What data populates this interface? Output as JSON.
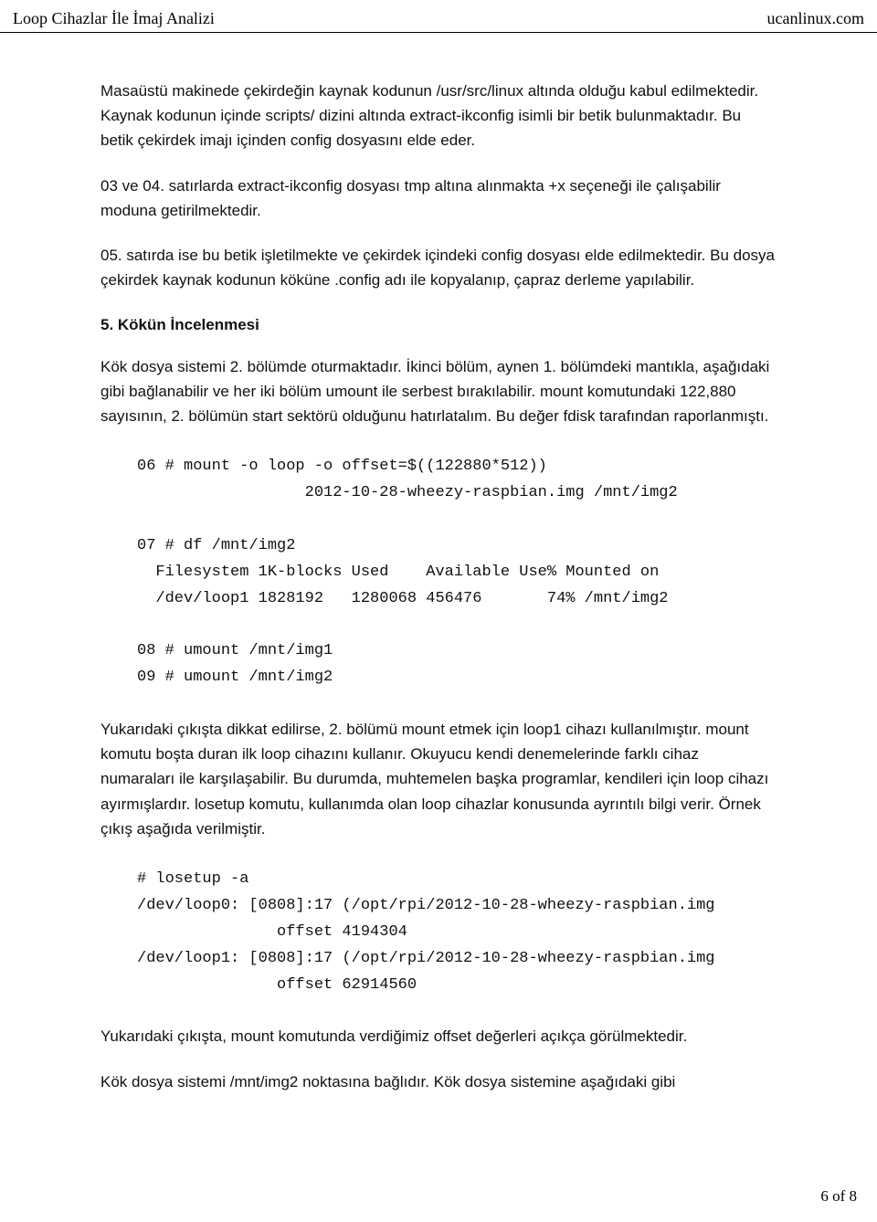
{
  "header": {
    "left": "Loop Cihazlar İle İmaj Analizi",
    "right": "ucanlinux.com"
  },
  "paragraphs": {
    "p1": "Masaüstü makinede çekirdeğin kaynak kodunun /usr/src/linux altında olduğu kabul edilmektedir. Kaynak kodunun içinde scripts/ dizini altında extract-ikconfig isimli bir betik bulunmaktadır. Bu betik çekirdek imajı içinden config dosyasını elde eder.",
    "p2": "03 ve 04. satırlarda extract-ikconfig dosyası tmp altına alınmakta +x seçeneği ile çalışabilir moduna getirilmektedir.",
    "p3": "05. satırda ise bu betik işletilmekte ve çekirdek içindeki config dosyası elde edilmektedir. Bu dosya çekirdek kaynak kodunun köküne .config adı ile kopyalanıp, çapraz derleme yapılabilir.",
    "sectionTitle": "5. Kökün İncelenmesi",
    "p4": "Kök dosya sistemi 2. bölümde oturmaktadır. İkinci bölüm, aynen 1. bölümdeki mantıkla, aşağıdaki gibi bağlanabilir ve her iki bölüm umount ile serbest bırakılabilir. mount komutundaki 122,880 sayısının, 2. bölümün start sektörü olduğunu hatırlatalım. Bu değer fdisk tarafından raporlanmıştı.",
    "p5": "Yukarıdaki çıkışta dikkat edilirse, 2. bölümü mount etmek için loop1 cihazı kullanılmıştır. mount komutu boşta duran ilk loop cihazını kullanır. Okuyucu kendi denemelerinde farklı cihaz numaraları ile karşılaşabilir. Bu durumda, muhtemelen başka programlar, kendileri için loop cihazı ayırmışlardır. losetup komutu, kullanımda olan loop cihazlar konusunda ayrıntılı bilgi verir. Örnek çıkış aşağıda verilmiştir.",
    "p6": "Yukarıdaki çıkışta, mount komutunda verdiğimiz offset değerleri açıkça görülmektedir.",
    "p7": "Kök dosya sistemi /mnt/img2 noktasına bağlıdır. Kök dosya sistemine aşağıdaki gibi"
  },
  "code1": "06 # mount -o loop -o offset=$((122880*512))\n                  2012-10-28-wheezy-raspbian.img /mnt/img2\n\n07 # df /mnt/img2\n  Filesystem 1K-blocks Used    Available Use% Mounted on\n  /dev/loop1 1828192   1280068 456476       74% /mnt/img2\n\n08 # umount /mnt/img1\n09 # umount /mnt/img2",
  "code2": "# losetup -a\n/dev/loop0: [0808]:17 (/opt/rpi/2012-10-28-wheezy-raspbian.img\n               offset 4194304\n/dev/loop1: [0808]:17 (/opt/rpi/2012-10-28-wheezy-raspbian.img\n               offset 62914560",
  "footer": {
    "pageIndicator": "6 of 8"
  }
}
